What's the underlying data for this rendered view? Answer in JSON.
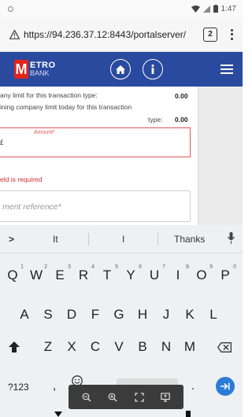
{
  "status_bar": {
    "time": "1:47"
  },
  "browser": {
    "url": "https://94.236.37.12:8443/portalserver/",
    "tab_count": "2"
  },
  "header": {
    "logo_line1": "ETRO",
    "logo_line2": "BANK",
    "logo_letter": "M",
    "brand_color": "#2a4a9f",
    "home_icon": "home-icon",
    "info_icon": "info-icon",
    "menu_icon": "hamburger-icon"
  },
  "form": {
    "limit1_label": "any limit for this transaction type:",
    "limit1_value": "0.00",
    "limit2_label_a": "ining company limit today for this transaction",
    "limit2_label_b": "type:",
    "limit2_value": "0.00",
    "amount_label": "Amount*",
    "amount_value": "",
    "prefix_glyph": "£",
    "error_text": "eld is required",
    "reference_placeholder": "ment reference*"
  },
  "keyboard": {
    "suggestions": [
      ">",
      "It",
      "I",
      "Thanks"
    ],
    "row1": [
      "Q",
      "W",
      "E",
      "R",
      "T",
      "Y",
      "U",
      "I",
      "O",
      "P"
    ],
    "row1_hints": [
      "1",
      "2",
      "3",
      "4",
      "5",
      "6",
      "7",
      "8",
      "9",
      "0"
    ],
    "row2": [
      "A",
      "S",
      "D",
      "F",
      "G",
      "H",
      "J",
      "K",
      "L"
    ],
    "row3": [
      "Z",
      "X",
      "C",
      "V",
      "B",
      "N",
      "M"
    ],
    "mode_key": "?123",
    "comma_key": ",",
    "period_key": "."
  },
  "zoom_toolbar": {
    "icons": [
      "zoom-out-icon",
      "zoom-in-icon",
      "fullscreen-icon",
      "screen-share-icon"
    ]
  }
}
